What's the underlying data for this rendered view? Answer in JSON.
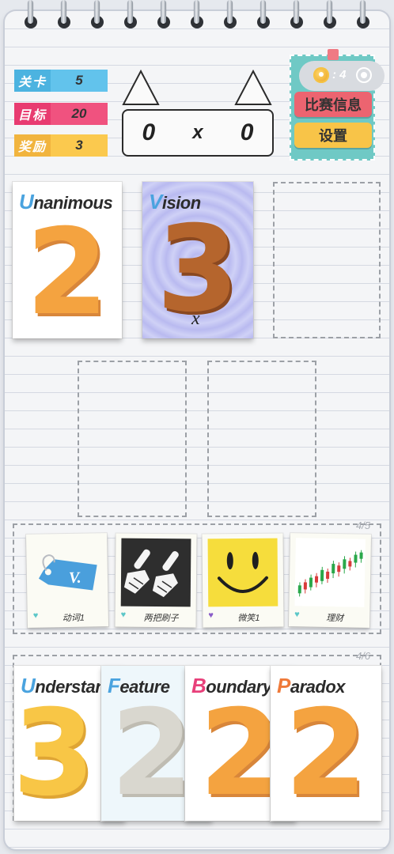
{
  "level_info": {
    "level": {
      "label": "关卡",
      "value": "5",
      "label_color": "#4cb3e0",
      "value_color": "#62c3ec"
    },
    "target": {
      "label": "目标",
      "value": "20",
      "label_color": "#e83b70",
      "value_color": "#f0527f"
    },
    "reward": {
      "label": "奖励",
      "value": "3",
      "label_color": "#f1b43e",
      "value_color": "#fbc94e"
    }
  },
  "score": {
    "left": "0",
    "separator": "x",
    "right": "0"
  },
  "panel": {
    "coins": ": 4",
    "match_info_label": "比赛信息",
    "settings_label": "设置",
    "colors": {
      "panel": "#6fc9c5",
      "match_button": "#ec6470",
      "settings_button": "#f8c448"
    }
  },
  "play_cards": [
    {
      "initial": "U",
      "rest": "nanimous",
      "number": "2",
      "initial_color": "#4aa3df",
      "number_color": "#f4a340"
    },
    {
      "initial": "V",
      "rest": "ision",
      "number": "3",
      "mark": "x",
      "initial_color": "#4aa3df",
      "number_color": "#b5652d"
    }
  ],
  "hint_zone": {
    "count": "4/5",
    "cards": [
      {
        "label": "动词1",
        "icon": "price-tag-icon",
        "tag_text": "V.",
        "heart_color": "#5cc7c8"
      },
      {
        "label": "两把刷子",
        "icon": "two-brushes-icon",
        "heart_color": "#5cc7c8"
      },
      {
        "label": "微笑1",
        "icon": "smiley-face-icon",
        "heart_color": "#8a5cc8"
      },
      {
        "label": "理财",
        "icon": "stock-chart-icon",
        "heart_color": "#5cc7c8"
      }
    ]
  },
  "hand": {
    "count": "4/6",
    "cards": [
      {
        "initial": "U",
        "rest": "nderstand",
        "number": "3",
        "initial_color": "#4aa3df",
        "number_color": "#f8c646"
      },
      {
        "initial": "F",
        "rest": "eature",
        "number": "2",
        "initial_color": "#4aa3df",
        "number_color": "#d9d7cf"
      },
      {
        "initial": "B",
        "rest": "oundary",
        "number": "2",
        "initial_color": "#e8407a",
        "number_color": "#f4a340"
      },
      {
        "initial": "P",
        "rest": "aradox",
        "number": "2",
        "initial_color": "#ef7a3a",
        "number_color": "#f4a340"
      }
    ]
  }
}
